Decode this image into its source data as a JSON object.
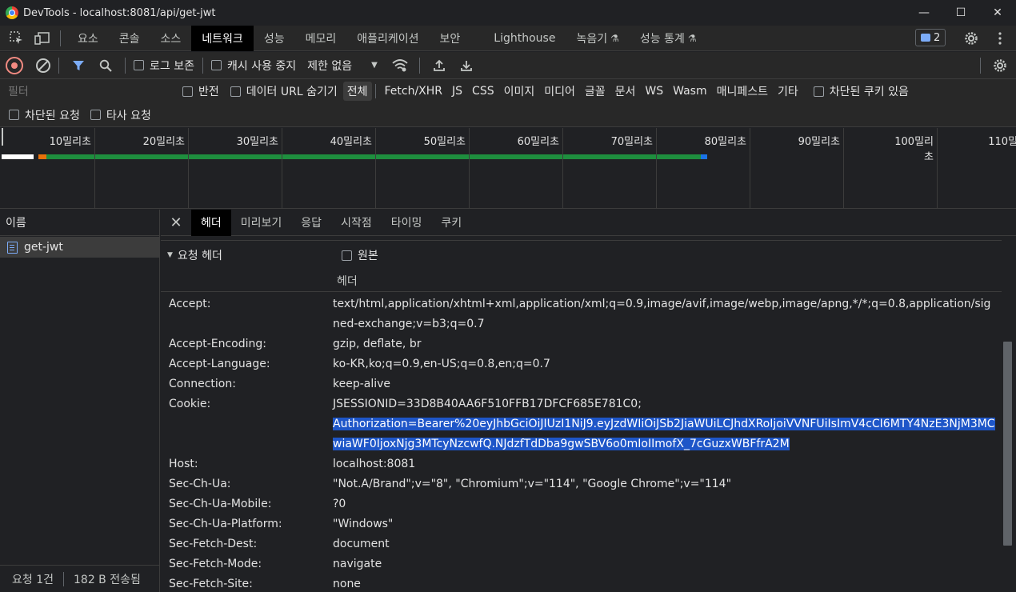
{
  "window": {
    "title": "DevTools - localhost:8081/api/get-jwt",
    "minimize": "—",
    "maximize": "☐",
    "close": "✕"
  },
  "main_tabs": [
    "요소",
    "콘솔",
    "소스",
    "네트워크",
    "성능",
    "메모리",
    "애플리케이션",
    "보안",
    "Lighthouse",
    "녹음기",
    "성능 통계"
  ],
  "active_main_tab": "네트워크",
  "issues_count": "2",
  "toolbar": {
    "preserve_log": "로그 보존",
    "disable_cache": "캐시 사용 중지",
    "throttling": "제한 없음"
  },
  "filter": {
    "placeholder": "필터",
    "invert": "반전",
    "hide_data_urls": "데이터 URL 숨기기",
    "types": [
      "전체",
      "Fetch/XHR",
      "JS",
      "CSS",
      "이미지",
      "미디어",
      "글꼴",
      "문서",
      "WS",
      "Wasm",
      "매니페스트",
      "기타"
    ],
    "blocked_cookies": "차단된 쿠키 있음",
    "blocked_requests": "차단된 요청",
    "third_party": "타사 요청"
  },
  "timeline": {
    "ticks": [
      "10밀리초",
      "20밀리초",
      "30밀리초",
      "40밀리초",
      "50밀리초",
      "60밀리초",
      "70밀리초",
      "80밀리초",
      "90밀리초",
      "100밀리초",
      "110밀리초"
    ]
  },
  "name_panel": {
    "header": "이름",
    "rows": [
      "get-jwt"
    ],
    "status_requests": "요청 1건",
    "status_transferred": "182 B 전송됨"
  },
  "detail": {
    "tabs": [
      "헤더",
      "미리보기",
      "응답",
      "시작점",
      "타이밍",
      "쿠키"
    ],
    "active_tab": "헤더",
    "section_title": "요청 헤더",
    "raw_label": "원본",
    "column_label": "헤더",
    "headers": [
      {
        "name": "Accept:",
        "value": "text/html,application/xhtml+xml,application/xml;q=0.9,image/avif,image/webp,image/apng,*/*;q=0.8,application/signed-exchange;v=b3;q=0.7"
      },
      {
        "name": "Accept-Encoding:",
        "value": "gzip, deflate, br"
      },
      {
        "name": "Accept-Language:",
        "value": "ko-KR,ko;q=0.9,en-US;q=0.8,en;q=0.7"
      },
      {
        "name": "Connection:",
        "value": "keep-alive"
      },
      {
        "name": "Cookie:",
        "value": "JSESSIONID=33D8B40AA6F510FFB17DFCF685E781C0;",
        "highlight": "Authorization=Bearer%20eyJhbGciOiJIUzI1NiJ9.eyJzdWIiOiJSb2JiaWUiLCJhdXRoIjoiVVNFUiIsImV4cCI6MTY4NzE3NjM3MCwiaWF0IjoxNjg3MTcyNzcwfQ.NJdzfTdDba9gwSBV6o0mIoIImofX_7cGuzxWBFfrA2M"
      },
      {
        "name": "Host:",
        "value": "localhost:8081"
      },
      {
        "name": "Sec-Ch-Ua:",
        "value": "\"Not.A/Brand\";v=\"8\", \"Chromium\";v=\"114\", \"Google Chrome\";v=\"114\""
      },
      {
        "name": "Sec-Ch-Ua-Mobile:",
        "value": "?0"
      },
      {
        "name": "Sec-Ch-Ua-Platform:",
        "value": "\"Windows\""
      },
      {
        "name": "Sec-Fetch-Dest:",
        "value": "document"
      },
      {
        "name": "Sec-Fetch-Mode:",
        "value": "navigate"
      },
      {
        "name": "Sec-Fetch-Site:",
        "value": "none"
      }
    ]
  }
}
